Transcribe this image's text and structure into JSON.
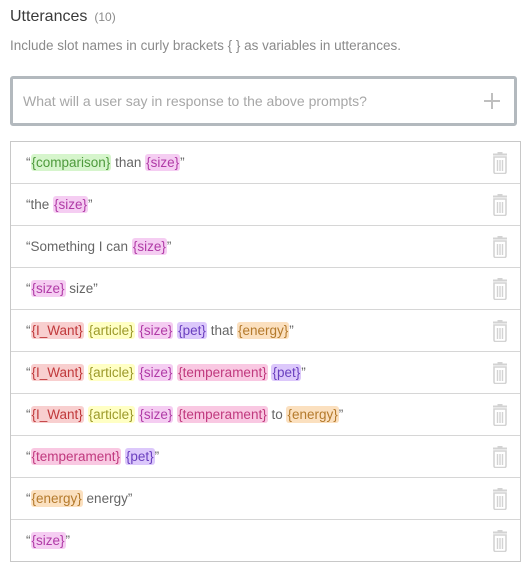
{
  "header": {
    "title": "Utterances",
    "count": "(10)"
  },
  "help_text": "Include slot names in curly brackets { } as variables in utterances.",
  "input": {
    "placeholder": "What will a user say in response to the above prompts?",
    "value": ""
  },
  "slot_colors": {
    "comparison": "#d6f5cc",
    "size": "#f5cdf2",
    "article": "#ffffc4",
    "pet": "#dcc8fb",
    "energy": "#fbe0bf",
    "I_Want": "#f8cfcf",
    "temperament": "#f9c8e2"
  },
  "slot_text_colors": {
    "comparison": "#4e9a3c",
    "size": "#b03aa6",
    "article": "#9c9a2a",
    "pet": "#6a3fbf",
    "energy": "#b47a2c",
    "I_Want": "#c0393b",
    "temperament": "#c0397e"
  },
  "utterances": [
    [
      {
        "t": "“"
      },
      {
        "s": "{comparison}",
        "k": "comparison"
      },
      {
        "t": " than "
      },
      {
        "s": "{size}",
        "k": "size"
      },
      {
        "t": "”"
      }
    ],
    [
      {
        "t": "“the "
      },
      {
        "s": "{size}",
        "k": "size"
      },
      {
        "t": "”"
      }
    ],
    [
      {
        "t": "“Something I can "
      },
      {
        "s": "{size}",
        "k": "size"
      },
      {
        "t": "”"
      }
    ],
    [
      {
        "t": "“"
      },
      {
        "s": "{size}",
        "k": "size"
      },
      {
        "t": " size”"
      }
    ],
    [
      {
        "t": "“"
      },
      {
        "s": "{I_Want}",
        "k": "I_Want"
      },
      {
        "t": " "
      },
      {
        "s": "{article}",
        "k": "article"
      },
      {
        "t": " "
      },
      {
        "s": "{size}",
        "k": "size"
      },
      {
        "t": " "
      },
      {
        "s": "{pet}",
        "k": "pet"
      },
      {
        "t": " that "
      },
      {
        "s": "{energy}",
        "k": "energy"
      },
      {
        "t": "”"
      }
    ],
    [
      {
        "t": "“"
      },
      {
        "s": "{I_Want}",
        "k": "I_Want"
      },
      {
        "t": " "
      },
      {
        "s": "{article}",
        "k": "article"
      },
      {
        "t": " "
      },
      {
        "s": "{size}",
        "k": "size"
      },
      {
        "t": " "
      },
      {
        "s": "{temperament}",
        "k": "temperament"
      },
      {
        "t": " "
      },
      {
        "s": "{pet}",
        "k": "pet"
      },
      {
        "t": "”"
      }
    ],
    [
      {
        "t": "“"
      },
      {
        "s": "{I_Want}",
        "k": "I_Want"
      },
      {
        "t": " "
      },
      {
        "s": "{article}",
        "k": "article"
      },
      {
        "t": " "
      },
      {
        "s": "{size}",
        "k": "size"
      },
      {
        "t": " "
      },
      {
        "s": "{temperament}",
        "k": "temperament"
      },
      {
        "t": " to "
      },
      {
        "s": "{energy}",
        "k": "energy"
      },
      {
        "t": "”"
      }
    ],
    [
      {
        "t": "“"
      },
      {
        "s": "{temperament}",
        "k": "temperament"
      },
      {
        "t": " "
      },
      {
        "s": "{pet}",
        "k": "pet"
      },
      {
        "t": "”"
      }
    ],
    [
      {
        "t": "“"
      },
      {
        "s": "{energy}",
        "k": "energy"
      },
      {
        "t": " energy”"
      }
    ],
    [
      {
        "t": "“"
      },
      {
        "s": "{size}",
        "k": "size"
      },
      {
        "t": "”"
      }
    ]
  ],
  "row_icon": "trash-icon"
}
